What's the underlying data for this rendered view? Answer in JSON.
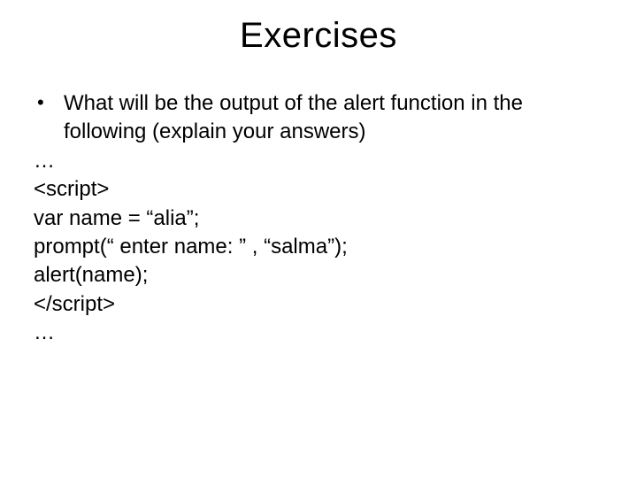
{
  "title": "Exercises",
  "bullet": "What will be the output of the alert function in the following (explain your answers)",
  "code": {
    "l1": "…",
    "l2": "<script>",
    "l3": "var name = “alia”;",
    "l4": "prompt(“ enter name: ” , “salma”);",
    "l5": "alert(name);",
    "l6": "</script>",
    "l7": "…"
  }
}
